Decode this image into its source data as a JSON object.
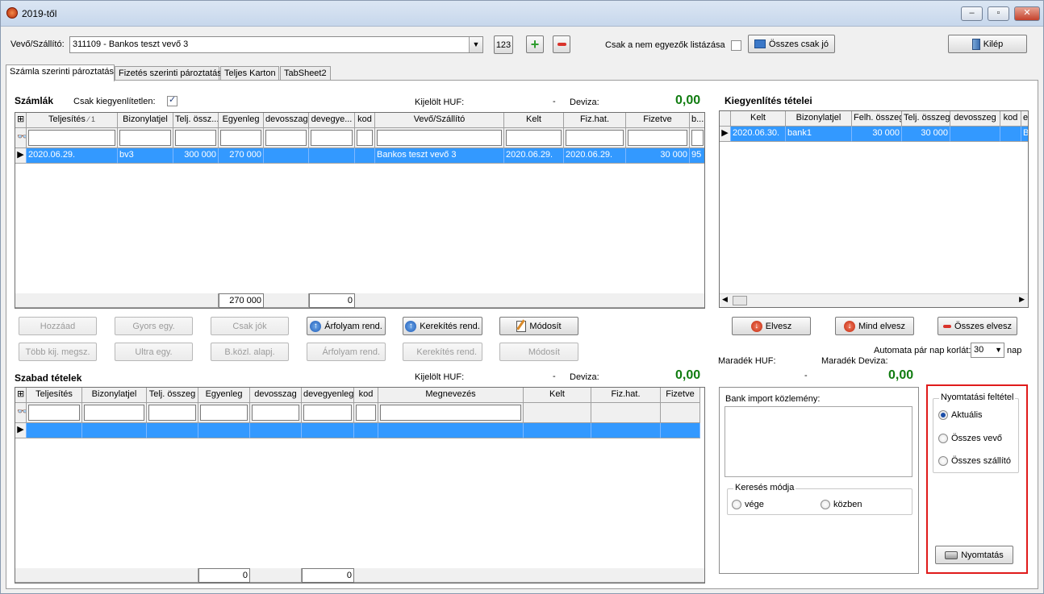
{
  "window": {
    "title": "2019-től"
  },
  "toolbar": {
    "partner_label": "Vevő/Szállító:",
    "partner_value": "311109 - Bankos teszt vevő 3",
    "code_button": "123",
    "only_mismatch_label": "Csak a nem egyezők listázása",
    "all_ok_button": "Összes csak jó",
    "exit_button": "Kilép"
  },
  "tabs": [
    "Számla szerinti pároztatás",
    "Fizetés szerinti pároztatás",
    "Teljes Karton",
    "TabSheet2"
  ],
  "invoices": {
    "title": "Számlák",
    "only_unsettled_label": "Csak kiegyenlítetlen:",
    "selected_huf_label": "Kijelölt HUF:",
    "selected_huf_value": "-",
    "currency_label": "Deviza:",
    "currency_value": "0,00",
    "columns": [
      "Teljesítés",
      "Bizonylatjel",
      "Telj. össz...",
      "Egyenleg",
      "devosszag",
      "devegye...",
      "kod",
      "Vevő/Szállító",
      "Kelt",
      "Fiz.hat.",
      "Fizetve",
      "b..."
    ],
    "sort_mark": "1",
    "rows": [
      [
        "2020.06.29.",
        "bv3",
        "300 000",
        "270 000",
        "",
        "",
        "",
        "Bankos teszt vevő 3",
        "2020.06.29.",
        "2020.06.29.",
        "30 000",
        "95"
      ]
    ],
    "footer": {
      "egyenleg_sum": "270 000",
      "devegy_sum": "0"
    }
  },
  "invoice_buttons": {
    "add": "Hozzáad",
    "quick": "Gyors egy.",
    "only_good": "Csak jók",
    "rate_rend": "Árfolyam rend.",
    "rounding_rend": "Kerekítés rend.",
    "modify": "Módosít",
    "multi": "Több kij. megsz.",
    "ultra": "Ultra egy.",
    "bkozl": "B.közl. alapj.",
    "rate_rend2": "Árfolyam rend.",
    "rounding_rend2": "Kerekítés rend.",
    "modify2": "Módosít"
  },
  "free_items": {
    "title": "Szabad tételek",
    "selected_huf_label": "Kijelölt HUF:",
    "selected_huf_value": "-",
    "currency_label": "Deviza:",
    "currency_value": "0,00",
    "columns": [
      "Teljesítés",
      "Bizonylatjel",
      "Telj. összeg",
      "Egyenleg",
      "devosszag",
      "devegyenleg",
      "kod",
      "Megnevezés",
      "Kelt",
      "Fiz.hat.",
      "Fizetve"
    ],
    "footer": {
      "egyenleg_sum": "0",
      "devegy_sum": "0"
    }
  },
  "settlement": {
    "title": "Kiegyenlítés tételei",
    "columns": [
      "Kelt",
      "Bizonylatjel",
      "Felh. összeg",
      "Telj. összeg",
      "devosszeg",
      "kod",
      "e..."
    ],
    "rows": [
      [
        "2020.06.30.",
        "bank1",
        "30 000",
        "30 000",
        "",
        "",
        "B"
      ]
    ],
    "remove_button": "Elvesz",
    "remove_all_button": "Mind elvesz",
    "remove_total_button": "Összes elvesz",
    "auto_pair_label": "Automata pár nap korlát:",
    "auto_pair_value": "30",
    "days_label": "nap",
    "remaining_huf_label": "Maradék HUF:",
    "remaining_huf_value": "-",
    "remaining_dev_label": "Maradék Deviza:",
    "remaining_dev_value": "0,00"
  },
  "bank_import": {
    "label": "Bank import közlemény:",
    "search_mode_title": "Keresés módja",
    "end_option": "vége",
    "middle_option": "közben"
  },
  "print": {
    "title": "Nyomtatási feltétel",
    "options": [
      "Aktuális",
      "Összes vevő",
      "Összes szállító"
    ],
    "selected": "Aktuális",
    "button": "Nyomtatás"
  },
  "colors": {
    "selection": "#3399ff",
    "green_value": "#107c10",
    "highlight_frame": "#e01b1b"
  }
}
